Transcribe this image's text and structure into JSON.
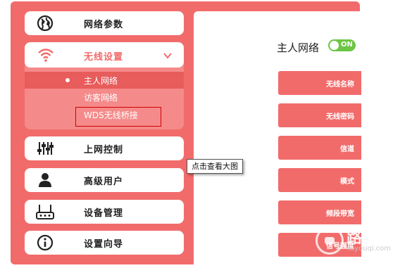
{
  "sidebar": {
    "network_params": {
      "label": "网络参数",
      "icon": "globe-icon"
    },
    "wireless": {
      "label": "无线设置",
      "icon": "wifi-icon",
      "expanded": true,
      "items": [
        {
          "label": "主人网络",
          "active": true
        },
        {
          "label": "访客网络",
          "active": false
        },
        {
          "label": "WDS无线桥接",
          "active": false,
          "highlighted": true
        }
      ]
    },
    "internet_control": {
      "label": "上网控制",
      "icon": "sliders-icon"
    },
    "advanced_users": {
      "label": "高级用户",
      "icon": "user-icon"
    },
    "device_mgmt": {
      "label": "设备管理",
      "icon": "router-icon"
    },
    "setup_wizard": {
      "label": "设置向导",
      "icon": "info-icon"
    }
  },
  "content": {
    "title": "主人网络",
    "toggle": {
      "state": "ON",
      "color": "#6cc644"
    },
    "fields": [
      {
        "label": "无线名称"
      },
      {
        "label": "无线密码"
      },
      {
        "label": "信道"
      },
      {
        "label": "模式"
      },
      {
        "label": "频段带宽"
      },
      {
        "label": "信号强度"
      }
    ]
  },
  "tooltip": {
    "text": "点击查看大图"
  },
  "watermark": {
    "name": "路由器",
    "domain": "luyouqi.com"
  },
  "colors": {
    "accent": "#f26b6b",
    "submenu_bg": "#f58a8a",
    "highlight_border": "#d00000"
  }
}
